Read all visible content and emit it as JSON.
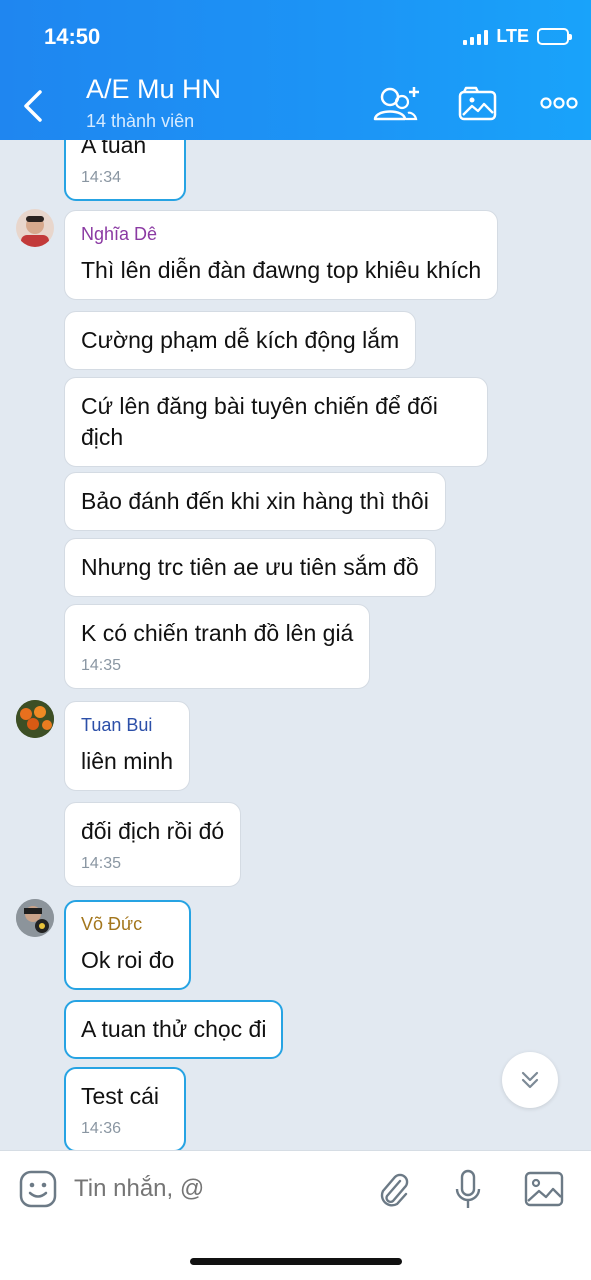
{
  "status_bar": {
    "time": "14:50",
    "network": "LTE"
  },
  "header": {
    "title": "A/E Mu HN",
    "subtitle": "14 thành viên"
  },
  "messages": [
    {
      "text": "A tuan",
      "time": "14:34"
    },
    {
      "sender": "Nghĩa Dê",
      "text": "Thì lên diễn đàn đawng top khiêu khích"
    },
    {
      "text": "Cường phạm dễ kích động lắm"
    },
    {
      "text": "Cứ lên đăng bài tuyên chiến để đối địch"
    },
    {
      "text": "Bảo đánh đến khi xin hàng thì thôi"
    },
    {
      "text": "Nhưng trc tiên ae ưu tiên sắm đồ"
    },
    {
      "text": "K có chiến tranh đồ lên giá",
      "time": "14:35"
    },
    {
      "sender": "Tuan Bui",
      "text": "liên minh"
    },
    {
      "text": "đối địch rồi đó",
      "time": "14:35"
    },
    {
      "sender": "Võ Đức",
      "text": "Ok roi đo"
    },
    {
      "text": "A tuan thử chọc đi"
    },
    {
      "text": "Test cái",
      "time": "14:36"
    }
  ],
  "sender_colors": {
    "Nghĩa Dê": "#8b3aa3",
    "Tuan Bui": "#2c4fa8",
    "Võ Đức": "#a3761c"
  },
  "input": {
    "placeholder": "Tin nhắn, @"
  },
  "accent_color": "#1c8ef5"
}
